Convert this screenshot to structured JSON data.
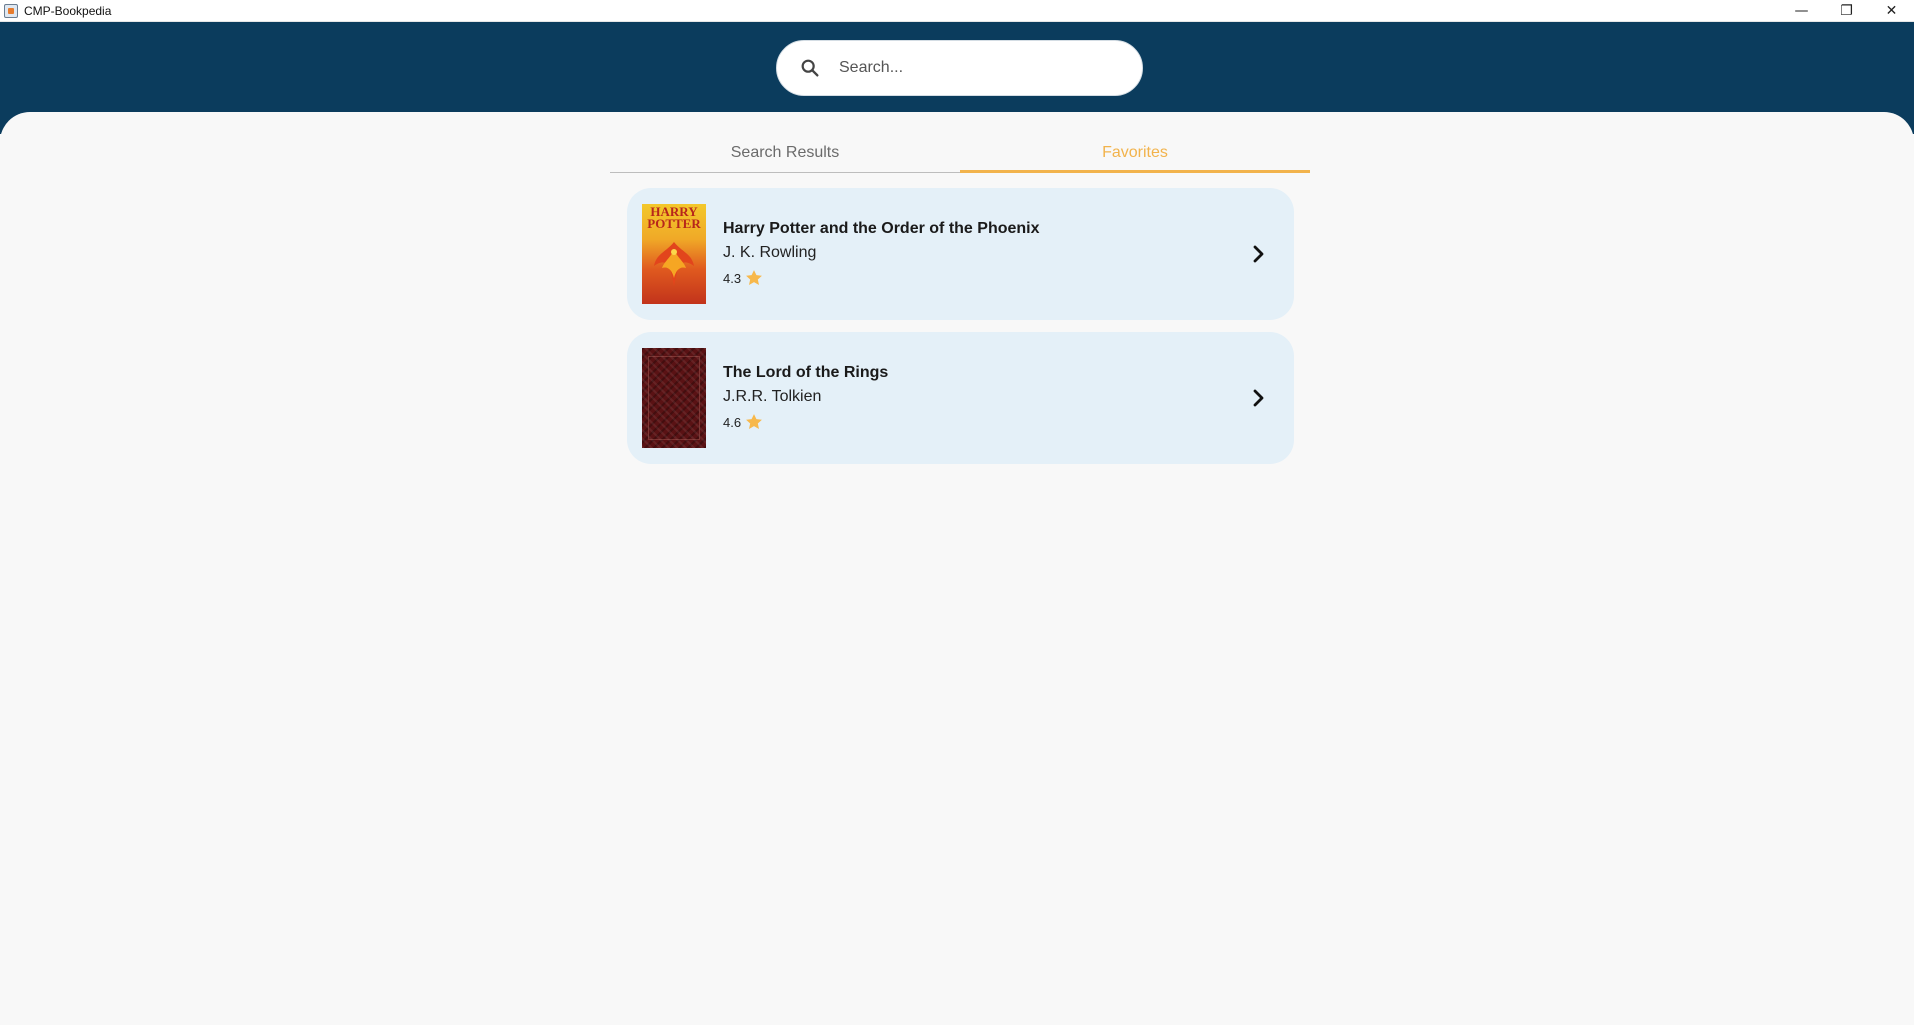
{
  "window": {
    "title": "CMP-Bookpedia",
    "minimize_glyph": "—",
    "maximize_glyph": "❐",
    "close_glyph": "✕"
  },
  "search": {
    "placeholder": "Search...",
    "value": ""
  },
  "tabs": [
    {
      "label": "Search Results",
      "active": false
    },
    {
      "label": "Favorites",
      "active": true
    }
  ],
  "colors": {
    "header": "#0b3c5d",
    "accent": "#f2b34c",
    "card": "#e4f0f8",
    "background": "#f8f8f8"
  },
  "books": [
    {
      "title": "Harry Potter and the Order of the Phoenix",
      "author": "J. K. Rowling",
      "rating": "4.3",
      "cover_text": "HARRY POTTER"
    },
    {
      "title": "The Lord of the Rings",
      "author": "J.R.R. Tolkien",
      "rating": "4.6"
    }
  ]
}
